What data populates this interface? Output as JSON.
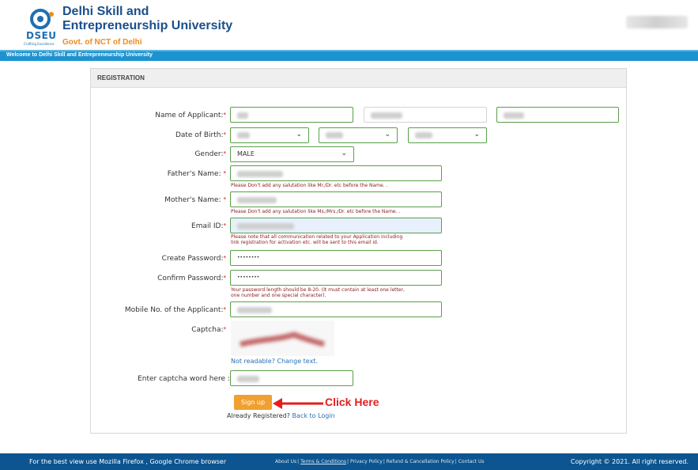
{
  "header": {
    "logo_text": "DSEU",
    "logo_tagline": "Crafting Excellence",
    "title_line1": "Delhi Skill and",
    "title_line2": "Entrepreneurship University",
    "subtitle": "Govt. of NCT of Delhi",
    "welcome": "Welcome to Delhi Skill and Entrepreneurship University"
  },
  "panel": {
    "title": "REGISTRATION"
  },
  "form": {
    "name_label": "Name of Applicant:",
    "dob_label": "Date of Birth:",
    "gender_label": "Gender:",
    "gender_value": "MALE",
    "father_label": "Father's Name: ",
    "father_note": "Please Don't add any salutation like Mr./Dr. etc before the Name. .",
    "mother_label": "Mother's Name: ",
    "mother_note": "Please Don't add any salutation like Ms./Mrs./Dr. etc before the Name. .",
    "email_label": "Email ID:",
    "email_note_1": "Please note that all communication related to your Application including",
    "email_note_2": "link registration for activation etc. will be sent to this email id.",
    "create_password_label": "Create Password:",
    "create_password_value": "••••••••",
    "confirm_password_label": "Confirm Password:",
    "confirm_password_value": "••••••••",
    "password_note_1": "Your password length should be 8-20. (It must contain at least one letter,",
    "password_note_2": "one number and one special character).",
    "mobile_label": "Mobile No. of the Applicant:",
    "captcha_label": "Captcha:",
    "captcha_refresh": "Not readable? Change text.",
    "captcha_entry_label": "Enter captcha word here :",
    "required_marker": "*",
    "signup_button": "Sign up",
    "annotation": "Click Here",
    "already_text": "Already Registered?",
    "login_link": "Back to Login"
  },
  "footer": {
    "left": "For the best view use Mozilla Firefox , Google Chrome browser",
    "links": [
      "About Us",
      "Terms & Conditions",
      "Privacy Policy",
      "Refund & Cancellation Policy",
      "Contact Us"
    ],
    "right": "Copyright © 2021. All right reserved."
  },
  "colors": {
    "accent": "#1c93d1",
    "footer": "#0d5590",
    "button": "#f0a030",
    "annotation": "#e41e1e"
  }
}
